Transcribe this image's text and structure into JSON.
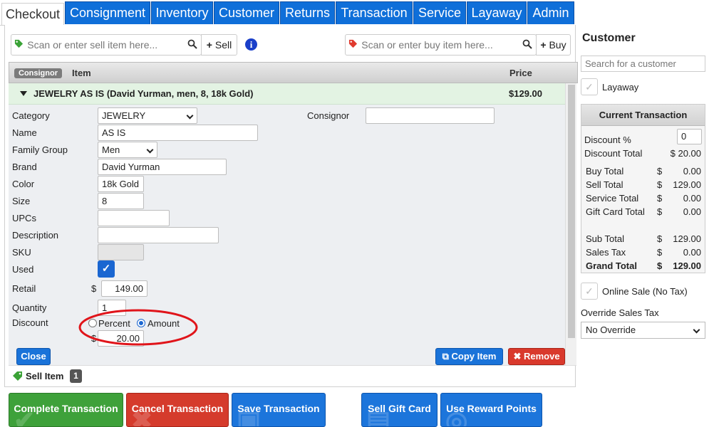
{
  "tabs": [
    {
      "label": "Checkout",
      "active": true
    },
    {
      "label": "Consignment"
    },
    {
      "label": "Inventory"
    },
    {
      "label": "Customer"
    },
    {
      "label": "Returns"
    },
    {
      "label": "Transaction"
    },
    {
      "label": "Service"
    },
    {
      "label": "Layaway"
    },
    {
      "label": "Admin"
    }
  ],
  "scan": {
    "sell_placeholder": "Scan or enter sell item here...",
    "sell_button": "Sell",
    "buy_placeholder": "Scan or enter buy item here...",
    "buy_button": "Buy"
  },
  "table": {
    "consignor_badge": "Consignor",
    "item_header": "Item",
    "price_header": "Price"
  },
  "item": {
    "title": "JEWELRY AS IS (David Yurman, men, 8, 18k Gold)",
    "price": "$129.00"
  },
  "form": {
    "category_label": "Category",
    "category_value": "JEWELRY",
    "consignor_label": "Consignor",
    "consignor_value": "",
    "name_label": "Name",
    "name_value": "AS IS",
    "family_label": "Family Group",
    "family_value": "Men",
    "brand_label": "Brand",
    "brand_value": "David Yurman",
    "color_label": "Color",
    "color_value": "18k Gold",
    "size_label": "Size",
    "size_value": "8",
    "upcs_label": "UPCs",
    "upcs_value": "",
    "description_label": "Description",
    "description_value": "",
    "sku_label": "SKU",
    "sku_value": "",
    "used_label": "Used",
    "retail_label": "Retail",
    "retail_currency": "$",
    "retail_value": "149.00",
    "quantity_label": "Quantity",
    "quantity_value": "1",
    "discount_label": "Discount",
    "discount_percent": "Percent",
    "discount_amount": "Amount",
    "discount_currency": "$",
    "discount_value": "20.00"
  },
  "buttons": {
    "close": "Close",
    "copy_item": "Copy Item",
    "remove": "Remove"
  },
  "sell_item": {
    "label": "Sell Item",
    "count": "1"
  },
  "actions": {
    "complete": "Complete Transaction",
    "cancel": "Cancel Transaction",
    "save": "Save Transaction",
    "gift_card": "Sell Gift Card",
    "reward": "Use Reward Points"
  },
  "sidebar": {
    "title": "Customer",
    "search_placeholder": "Search for a customer",
    "layaway_label": "Layaway",
    "current_title": "Current Transaction",
    "discount_pct_label": "Discount %",
    "discount_pct_value": "0",
    "discount_total_label": "Discount Total",
    "discount_total_value": "$ 20.00",
    "rows": [
      {
        "label": "Buy Total",
        "cur": "$",
        "value": "0.00"
      },
      {
        "label": "Sell Total",
        "cur": "$",
        "value": "129.00"
      },
      {
        "label": "Service Total",
        "cur": "$",
        "value": "0.00"
      },
      {
        "label": "Gift Card Total",
        "cur": "$",
        "value": "0.00"
      },
      {
        "label": "Sub Total",
        "cur": "$",
        "value": "129.00"
      },
      {
        "label": "Sales Tax",
        "cur": "$",
        "value": "0.00"
      },
      {
        "label": "Grand Total",
        "cur": "$",
        "value": "129.00"
      }
    ],
    "online_sale_label": "Online Sale (No Tax)",
    "override_label": "Override Sales Tax",
    "override_value": "No Override"
  },
  "colors": {
    "tab_blue": "#0f6fd9",
    "highlight_red": "#e0141a",
    "item_row_green": "#e3f3e3"
  }
}
